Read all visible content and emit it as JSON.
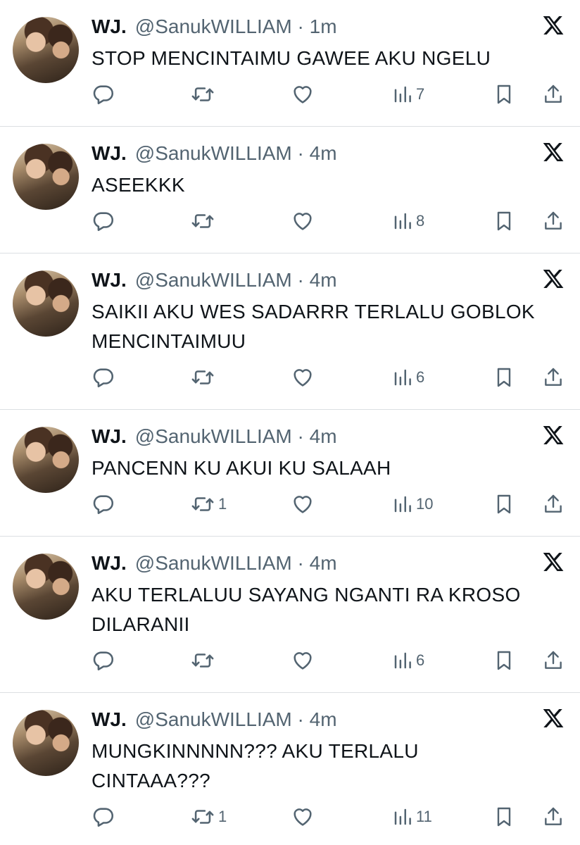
{
  "tweets": [
    {
      "name": "WJ.",
      "handle": "@SanukWILLIAM",
      "sep": " · ",
      "time": "1m",
      "text": "STOP MENCINTAIMU GAWEE AKU NGELU",
      "retweets": "",
      "views": "7"
    },
    {
      "name": "WJ.",
      "handle": "@SanukWILLIAM",
      "sep": " · ",
      "time": "4m",
      "text": "ASEEKKK",
      "retweets": "",
      "views": "8"
    },
    {
      "name": "WJ.",
      "handle": "@SanukWILLIAM",
      "sep": " · ",
      "time": "4m",
      "text": "SAIKII AKU WES SADARRR TERLALU GOBLOK MENCINTAIMUU",
      "retweets": "",
      "views": "6"
    },
    {
      "name": "WJ.",
      "handle": "@SanukWILLIAM",
      "sep": " · ",
      "time": "4m",
      "text": "PANCENN KU AKUI KU SALAAH",
      "retweets": "1",
      "views": "10"
    },
    {
      "name": "WJ.",
      "handle": "@SanukWILLIAM",
      "sep": " · ",
      "time": "4m",
      "text": "AKU TERLALUU SAYANG NGANTI RA KROSO DILARANII",
      "retweets": "",
      "views": "6"
    },
    {
      "name": "WJ.",
      "handle": "@SanukWILLIAM",
      "sep": " · ",
      "time": "4m",
      "text": "MUNGKINNNNN??? AKU TERLALU CINTAAA???",
      "retweets": "1",
      "views": "11"
    }
  ],
  "icons": {
    "reply": "reply-icon",
    "retweet": "retweet-icon",
    "like": "heart-icon",
    "views": "views-icon",
    "bookmark": "bookmark-icon",
    "share": "share-icon",
    "brand": "x-logo-icon"
  },
  "colors": {
    "text": "#0f1419",
    "muted": "#536471",
    "divider": "#dcdfe2"
  }
}
